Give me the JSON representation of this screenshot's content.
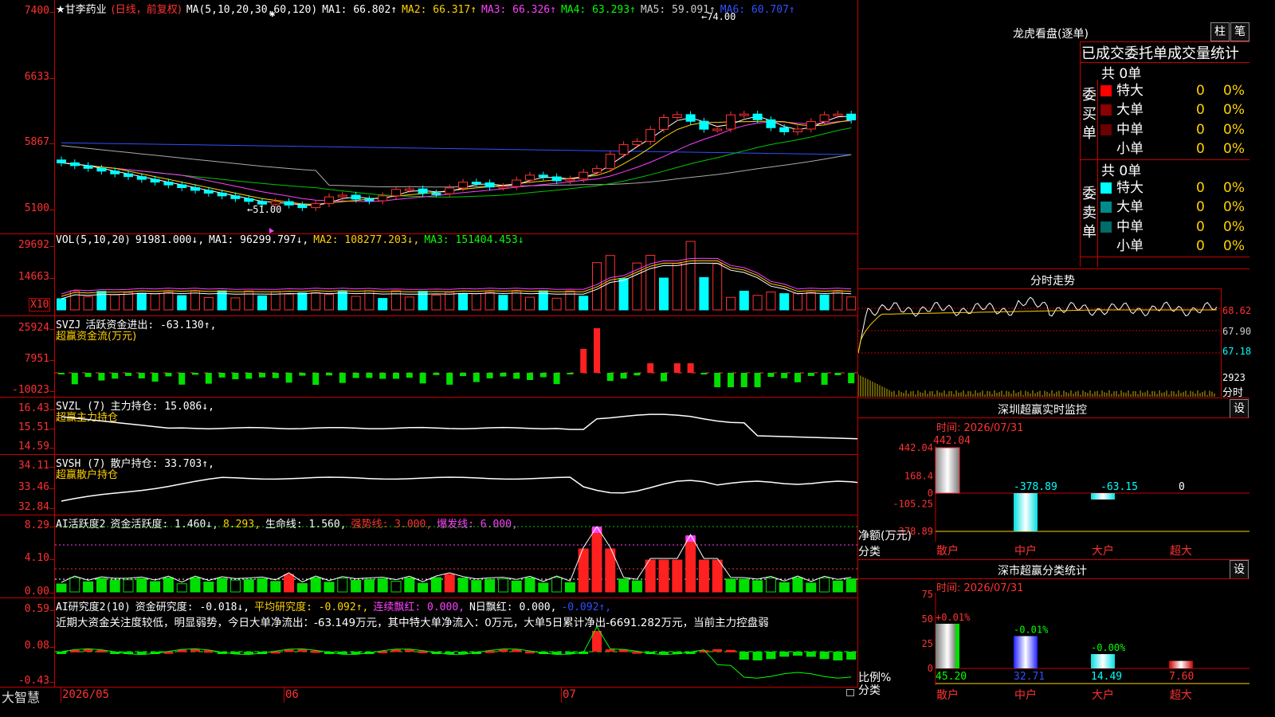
{
  "app": {
    "logo": "大智慧"
  },
  "main": {
    "title": "★甘李药业",
    "mode": "(日线，前复权)",
    "ma_label": "MA(5,10,20,30,60,120)",
    "ma_values": [
      {
        "label": "MA1:",
        "value": "66.802↑",
        "color": "#ffffff"
      },
      {
        "label": "MA2:",
        "value": "66.317↑",
        "color": "#ffd200"
      },
      {
        "label": "MA3:",
        "value": "66.326↑",
        "color": "#ff40ff"
      },
      {
        "label": "MA4:",
        "value": "63.293↑",
        "color": "#00ff00"
      },
      {
        "label": "MA5:",
        "value": "59.091↑",
        "color": "#cccccc"
      },
      {
        "label": "MA6:",
        "value": "60.707↑",
        "color": "#3050ff"
      }
    ],
    "y_labels": [
      "7400",
      "6633",
      "5867",
      "5100"
    ],
    "high_label": "74.00",
    "low_label": "51.00"
  },
  "vol": {
    "label": "VOL(5,10,20)",
    "value": "91981.000↓,",
    "ma": [
      {
        "label": "MA1:",
        "value": "96299.797↓,",
        "color": "#ffffff"
      },
      {
        "label": "MA2:",
        "value": "108277.203↓,",
        "color": "#ffd200"
      },
      {
        "label": "MA3:",
        "value": "151404.453↓",
        "color": "#00ff00"
      }
    ],
    "y_labels": [
      "29692",
      "14663"
    ],
    "unit": "X10"
  },
  "svzj": {
    "label": "SVZJ",
    "desc": "活跃资金进出: -63.130↑,",
    "sub": "超赢资金流(万元)",
    "y_labels": [
      "25924",
      "7951",
      "-10023"
    ]
  },
  "svzl": {
    "label": "SVZL (7)",
    "desc": "主力持仓: 15.086↓,",
    "sub": "超赢主力持仓",
    "y_labels": [
      "16.43",
      "15.51",
      "14.59"
    ]
  },
  "svsh": {
    "label": "SVSH (7)",
    "desc": "散户持仓: 33.703↑,",
    "sub": "超赢散户持仓",
    "y_labels": [
      "34.11",
      "33.46",
      "32.84"
    ]
  },
  "ai1": {
    "label": "AI活跃度2",
    "items": [
      {
        "text": "资金活跃度: 1.460↓,",
        "color": "#ffffff"
      },
      {
        "text": "8.293,",
        "color": "#ffd200"
      },
      {
        "text": "生命线: 1.560,",
        "color": "#ffffff"
      },
      {
        "text": "强势线: 3.000,",
        "color": "#ff3232"
      },
      {
        "text": "爆发线: 6.000,",
        "color": "#ff40ff"
      }
    ],
    "y_labels": [
      "8.29",
      "4.10",
      "0.00"
    ]
  },
  "ai2": {
    "label": "AI研究度2(10)",
    "items": [
      {
        "text": "资金研究度: -0.018↓,",
        "color": "#ffffff"
      },
      {
        "text": "平均研究度: -0.092↑,",
        "color": "#ffd200"
      },
      {
        "text": "连续飘红: 0.000,",
        "color": "#ff40ff"
      },
      {
        "text": "N日飘红: 0.000,",
        "color": "#ffffff"
      },
      {
        "text": "-0.092↑,",
        "color": "#3050ff"
      }
    ],
    "comment": "近期大资金关注度较低，明显弱势，今日大单净流出：-63.149万元，其中特大单净流入：0万元，大单5日累计净出-6691.282万元，当前主力控盘弱",
    "y_labels": [
      "0.59",
      "0.08",
      "-0.43"
    ]
  },
  "x_axis": [
    "2026/05",
    "06",
    "07"
  ],
  "lhb": {
    "title": "龙虎看盘(逐单)",
    "btn_bar": "柱",
    "btn_pen": "笔",
    "tabs": "已成交委托单成交量统计",
    "buy": {
      "side": "委买单",
      "total": "共 0单",
      "rows": [
        {
          "name": "特大",
          "count": "0",
          "pct": "0%",
          "color": "#ff0000"
        },
        {
          "name": "大单",
          "count": "0",
          "pct": "0%",
          "color": "#8b0000"
        },
        {
          "name": "中单",
          "count": "0",
          "pct": "0%",
          "color": "#6b0000"
        },
        {
          "name": "小单",
          "count": "0",
          "pct": "0%",
          "color": "#000000"
        }
      ]
    },
    "sell": {
      "side": "委卖单",
      "total": "共 0单",
      "rows": [
        {
          "name": "特大",
          "count": "0",
          "pct": "0%",
          "color": "#00ffff"
        },
        {
          "name": "大单",
          "count": "0",
          "pct": "0%",
          "color": "#008b8b"
        },
        {
          "name": "中单",
          "count": "0",
          "pct": "0%",
          "color": "#006b6b"
        },
        {
          "name": "小单",
          "count": "0",
          "pct": "0%",
          "color": "#000000"
        }
      ]
    }
  },
  "intraday": {
    "title": "分时走势",
    "y_labels": [
      "68.62",
      "67.90",
      "67.18"
    ],
    "vol_label": "2923",
    "vol_unit": "分时"
  },
  "monitor": {
    "title": "深圳超赢实时监控",
    "btn": "设",
    "time": "时间: 2026/07/31",
    "y_labels": [
      "442.04",
      "168.4",
      "0",
      "-105.25",
      "-378.89"
    ],
    "ylabel": "净额(万元)",
    "xlabel": "分类",
    "values": [
      "442.04",
      "-378.89",
      "-63.15",
      "0"
    ],
    "categories": [
      "散户",
      "中户",
      "大户",
      "超大"
    ]
  },
  "classify": {
    "title": "深市超赢分类统计",
    "btn": "设",
    "time": "时间: 2026/07/31",
    "y_labels": [
      "75",
      "50",
      "25",
      "0"
    ],
    "ylabel": "比例%",
    "xlabel": "分类",
    "changes": [
      "+0.01%",
      "-0.01%",
      "-0.00%"
    ],
    "values": [
      "45.20",
      "32.71",
      "14.49",
      "7.60"
    ],
    "categories": [
      "散户",
      "中户",
      "大户",
      "超大"
    ]
  },
  "chart_data": [
    {
      "type": "bar",
      "title": "深圳超赢实时监控",
      "xlabel": "分类",
      "ylabel": "净额(万元)",
      "categories": [
        "散户",
        "中户",
        "大户",
        "超大"
      ],
      "values": [
        442.04,
        -378.89,
        -63.15,
        0
      ],
      "ylim": [
        -378.89,
        442.04
      ]
    },
    {
      "type": "bar",
      "title": "深市超赢分类统计",
      "xlabel": "分类",
      "ylabel": "比例%",
      "categories": [
        "散户",
        "中户",
        "大户",
        "超大"
      ],
      "values": [
        45.2,
        32.71,
        14.49,
        7.6
      ],
      "ylim": [
        0,
        75
      ]
    }
  ]
}
